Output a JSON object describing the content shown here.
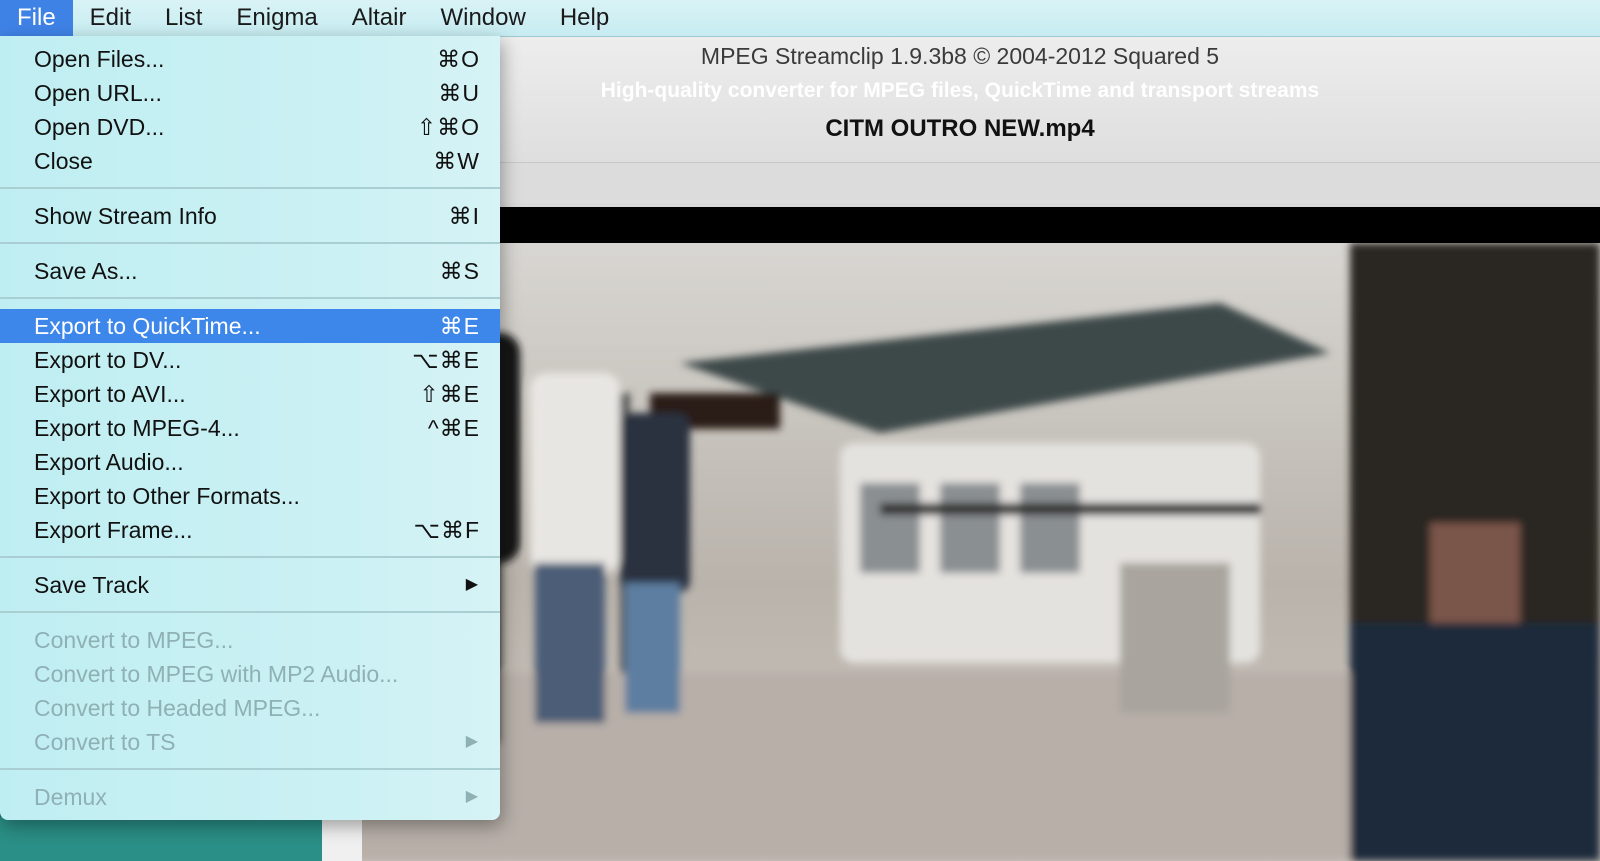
{
  "menubar": {
    "items": [
      "File",
      "Edit",
      "List",
      "Enigma",
      "Altair",
      "Window",
      "Help"
    ]
  },
  "window": {
    "app_title": "MPEG Streamclip 1.9.3b8  ©  2004-2012 Squared 5",
    "subtitle": "High-quality converter for MPEG files, QuickTime and transport streams",
    "filename": "CITM OUTRO NEW.mp4"
  },
  "file_menu": {
    "open_files": {
      "label": "Open Files...",
      "shortcut": "⌘O"
    },
    "open_url": {
      "label": "Open URL...",
      "shortcut": "⌘U"
    },
    "open_dvd": {
      "label": "Open DVD...",
      "shortcut": "⇧⌘O"
    },
    "close": {
      "label": "Close",
      "shortcut": "⌘W"
    },
    "show_stream_info": {
      "label": "Show Stream Info",
      "shortcut": "⌘I"
    },
    "save_as": {
      "label": "Save As...",
      "shortcut": "⌘S"
    },
    "export_quicktime": {
      "label": "Export to QuickTime...",
      "shortcut": "⌘E"
    },
    "export_dv": {
      "label": "Export to DV...",
      "shortcut": "⌥⌘E"
    },
    "export_avi": {
      "label": "Export to AVI...",
      "shortcut": "⇧⌘E"
    },
    "export_mpeg4": {
      "label": "Export to MPEG-4...",
      "shortcut": "^⌘E"
    },
    "export_audio": {
      "label": "Export Audio..."
    },
    "export_other": {
      "label": "Export to Other Formats..."
    },
    "export_frame": {
      "label": "Export Frame...",
      "shortcut": "⌥⌘F"
    },
    "save_track": {
      "label": "Save Track"
    },
    "convert_mpeg": {
      "label": "Convert to MPEG..."
    },
    "convert_mpeg_mp2": {
      "label": "Convert to MPEG with MP2 Audio..."
    },
    "convert_headed": {
      "label": "Convert to Headed MPEG..."
    },
    "convert_ts": {
      "label": "Convert to TS"
    },
    "demux": {
      "label": "Demux"
    }
  },
  "submenu_arrow": "▶",
  "colors": {
    "menu_bg": "#c6eff3",
    "selection": "#3d86ea",
    "disabled_text": "#8fb0b4"
  }
}
